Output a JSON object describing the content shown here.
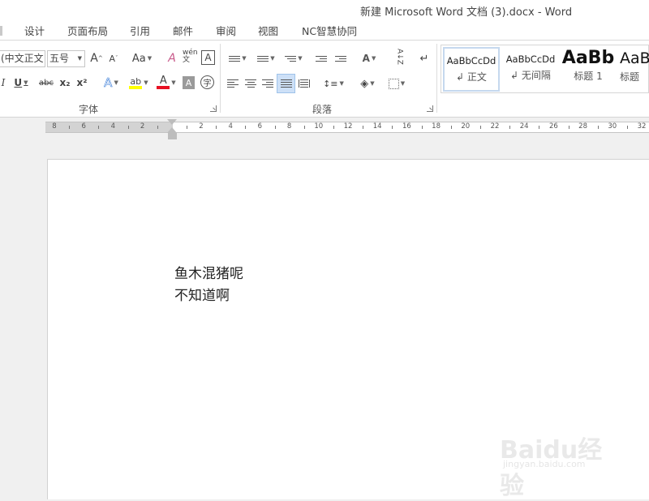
{
  "window": {
    "title": "新建 Microsoft Word 文档 (3).docx - Word"
  },
  "tabs": [
    "设计",
    "页面布局",
    "引用",
    "邮件",
    "审阅",
    "视图",
    "NC智慧协同"
  ],
  "font_group": {
    "label": "字体",
    "font_name": "(中文正文",
    "font_size": "五号",
    "grow_label": "A",
    "shrink_label": "A",
    "case_label": "Aa",
    "clear_label": "A",
    "phonetic_label": "wén文",
    "border_label": "A",
    "italic_label": "I",
    "underline_label": "U",
    "strike_label": "abc",
    "subscript_label": "x₂",
    "superscript_label": "x²",
    "effects_label": "A",
    "highlight_label": "ab",
    "font_color_label": "A",
    "shading_label": "A",
    "enclose_label": "字"
  },
  "paragraph_group": {
    "label": "段落",
    "sort_label": "A↓Z",
    "show_marks_label": "↵"
  },
  "styles": [
    {
      "sample": "AaBbCcDd",
      "name": "正文",
      "prefix": "↲ "
    },
    {
      "sample": "AaBbCcDd",
      "name": "无间隔",
      "prefix": "↲ "
    },
    {
      "sample": "AaBb",
      "name": "标题 1",
      "prefix": ""
    },
    {
      "sample": "AaB",
      "name": "标题",
      "prefix": ""
    }
  ],
  "ruler": {
    "labels": [
      "8",
      "6",
      "4",
      "2",
      "2",
      "4",
      "6",
      "8",
      "10",
      "12",
      "14",
      "16",
      "18",
      "20",
      "22",
      "24",
      "26",
      "28",
      "30",
      "32"
    ]
  },
  "document": {
    "lines": [
      "鱼木混猪呢",
      "不知道啊"
    ]
  },
  "watermark": {
    "text": "Baidu经验",
    "url": "jingyan.baidu.com"
  },
  "colors": {
    "highlight": "#ffff00",
    "font_color": "#e81123",
    "selected_button": "#cde0f7",
    "accent_blue": "#2b579a"
  }
}
